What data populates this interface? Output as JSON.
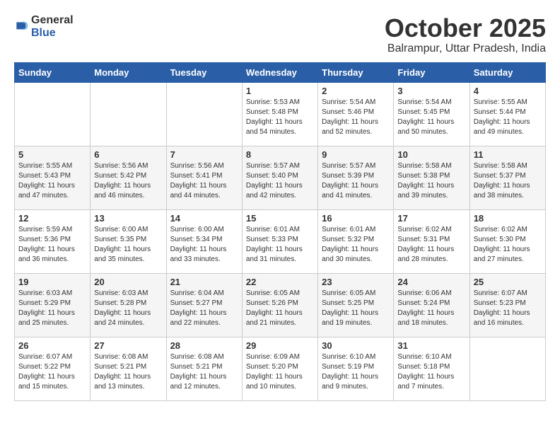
{
  "logo": {
    "general": "General",
    "blue": "Blue"
  },
  "header": {
    "month": "October 2025",
    "location": "Balrampur, Uttar Pradesh, India"
  },
  "weekdays": [
    "Sunday",
    "Monday",
    "Tuesday",
    "Wednesday",
    "Thursday",
    "Friday",
    "Saturday"
  ],
  "weeks": [
    [
      {
        "day": "",
        "info": ""
      },
      {
        "day": "",
        "info": ""
      },
      {
        "day": "",
        "info": ""
      },
      {
        "day": "1",
        "info": "Sunrise: 5:53 AM\nSunset: 5:48 PM\nDaylight: 11 hours\nand 54 minutes."
      },
      {
        "day": "2",
        "info": "Sunrise: 5:54 AM\nSunset: 5:46 PM\nDaylight: 11 hours\nand 52 minutes."
      },
      {
        "day": "3",
        "info": "Sunrise: 5:54 AM\nSunset: 5:45 PM\nDaylight: 11 hours\nand 50 minutes."
      },
      {
        "day": "4",
        "info": "Sunrise: 5:55 AM\nSunset: 5:44 PM\nDaylight: 11 hours\nand 49 minutes."
      }
    ],
    [
      {
        "day": "5",
        "info": "Sunrise: 5:55 AM\nSunset: 5:43 PM\nDaylight: 11 hours\nand 47 minutes."
      },
      {
        "day": "6",
        "info": "Sunrise: 5:56 AM\nSunset: 5:42 PM\nDaylight: 11 hours\nand 46 minutes."
      },
      {
        "day": "7",
        "info": "Sunrise: 5:56 AM\nSunset: 5:41 PM\nDaylight: 11 hours\nand 44 minutes."
      },
      {
        "day": "8",
        "info": "Sunrise: 5:57 AM\nSunset: 5:40 PM\nDaylight: 11 hours\nand 42 minutes."
      },
      {
        "day": "9",
        "info": "Sunrise: 5:57 AM\nSunset: 5:39 PM\nDaylight: 11 hours\nand 41 minutes."
      },
      {
        "day": "10",
        "info": "Sunrise: 5:58 AM\nSunset: 5:38 PM\nDaylight: 11 hours\nand 39 minutes."
      },
      {
        "day": "11",
        "info": "Sunrise: 5:58 AM\nSunset: 5:37 PM\nDaylight: 11 hours\nand 38 minutes."
      }
    ],
    [
      {
        "day": "12",
        "info": "Sunrise: 5:59 AM\nSunset: 5:36 PM\nDaylight: 11 hours\nand 36 minutes."
      },
      {
        "day": "13",
        "info": "Sunrise: 6:00 AM\nSunset: 5:35 PM\nDaylight: 11 hours\nand 35 minutes."
      },
      {
        "day": "14",
        "info": "Sunrise: 6:00 AM\nSunset: 5:34 PM\nDaylight: 11 hours\nand 33 minutes."
      },
      {
        "day": "15",
        "info": "Sunrise: 6:01 AM\nSunset: 5:33 PM\nDaylight: 11 hours\nand 31 minutes."
      },
      {
        "day": "16",
        "info": "Sunrise: 6:01 AM\nSunset: 5:32 PM\nDaylight: 11 hours\nand 30 minutes."
      },
      {
        "day": "17",
        "info": "Sunrise: 6:02 AM\nSunset: 5:31 PM\nDaylight: 11 hours\nand 28 minutes."
      },
      {
        "day": "18",
        "info": "Sunrise: 6:02 AM\nSunset: 5:30 PM\nDaylight: 11 hours\nand 27 minutes."
      }
    ],
    [
      {
        "day": "19",
        "info": "Sunrise: 6:03 AM\nSunset: 5:29 PM\nDaylight: 11 hours\nand 25 minutes."
      },
      {
        "day": "20",
        "info": "Sunrise: 6:03 AM\nSunset: 5:28 PM\nDaylight: 11 hours\nand 24 minutes."
      },
      {
        "day": "21",
        "info": "Sunrise: 6:04 AM\nSunset: 5:27 PM\nDaylight: 11 hours\nand 22 minutes."
      },
      {
        "day": "22",
        "info": "Sunrise: 6:05 AM\nSunset: 5:26 PM\nDaylight: 11 hours\nand 21 minutes."
      },
      {
        "day": "23",
        "info": "Sunrise: 6:05 AM\nSunset: 5:25 PM\nDaylight: 11 hours\nand 19 minutes."
      },
      {
        "day": "24",
        "info": "Sunrise: 6:06 AM\nSunset: 5:24 PM\nDaylight: 11 hours\nand 18 minutes."
      },
      {
        "day": "25",
        "info": "Sunrise: 6:07 AM\nSunset: 5:23 PM\nDaylight: 11 hours\nand 16 minutes."
      }
    ],
    [
      {
        "day": "26",
        "info": "Sunrise: 6:07 AM\nSunset: 5:22 PM\nDaylight: 11 hours\nand 15 minutes."
      },
      {
        "day": "27",
        "info": "Sunrise: 6:08 AM\nSunset: 5:21 PM\nDaylight: 11 hours\nand 13 minutes."
      },
      {
        "day": "28",
        "info": "Sunrise: 6:08 AM\nSunset: 5:21 PM\nDaylight: 11 hours\nand 12 minutes."
      },
      {
        "day": "29",
        "info": "Sunrise: 6:09 AM\nSunset: 5:20 PM\nDaylight: 11 hours\nand 10 minutes."
      },
      {
        "day": "30",
        "info": "Sunrise: 6:10 AM\nSunset: 5:19 PM\nDaylight: 11 hours\nand 9 minutes."
      },
      {
        "day": "31",
        "info": "Sunrise: 6:10 AM\nSunset: 5:18 PM\nDaylight: 11 hours\nand 7 minutes."
      },
      {
        "day": "",
        "info": ""
      }
    ]
  ]
}
